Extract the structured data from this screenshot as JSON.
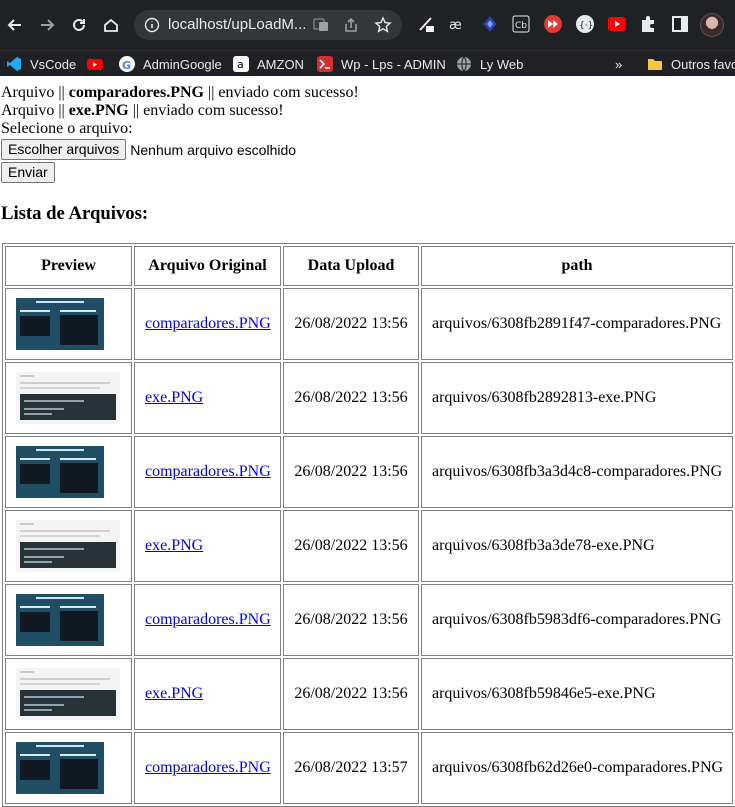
{
  "browser": {
    "url": "localhost/upLoadM...",
    "bookmarks": [
      {
        "label": "VsCode",
        "icon": "vscode-icon",
        "color": "#23a9f2"
      },
      {
        "label": "",
        "icon": "youtube-icon",
        "color": "#ff0000"
      },
      {
        "label": "AdminGoogle",
        "icon": "google-icon",
        "color": "#ffffff"
      },
      {
        "label": "AMZON",
        "icon": "amazon-icon",
        "color": "#ffffff"
      },
      {
        "label": "Wp - Lps - ADMIN",
        "icon": "wp-icon",
        "color": "#d32f2f"
      },
      {
        "label": "Ly Web",
        "icon": "globe-icon",
        "color": "#9aa0a6"
      }
    ],
    "more_label": "»",
    "other_folder_label": "Outros favor"
  },
  "page": {
    "messages": [
      {
        "prefix": "Arquivo || ",
        "filename": "comparadores.PNG",
        "suffix": " || enviado com sucesso!"
      },
      {
        "prefix": "Arquivo || ",
        "filename": "exe.PNG",
        "suffix": " || enviado com sucesso!"
      }
    ],
    "select_label": "Selecione o arquivo:",
    "choose_button": "Escolher arquivos",
    "no_file_text": "Nenhum arquivo escolhido",
    "send_button": "Enviar",
    "list_title": "Lista de Arquivos:",
    "table": {
      "headers": [
        "Preview",
        "Arquivo Original",
        "Data Upload",
        "path"
      ],
      "rows": [
        {
          "thumb": "comp",
          "name": "comparadores.PNG",
          "date": "26/08/2022 13:56",
          "path": "arquivos/6308fb2891f47-comparadores.PNG"
        },
        {
          "thumb": "exe",
          "name": "exe.PNG",
          "date": "26/08/2022 13:56",
          "path": "arquivos/6308fb2892813-exe.PNG"
        },
        {
          "thumb": "comp",
          "name": "comparadores.PNG",
          "date": "26/08/2022 13:56",
          "path": "arquivos/6308fb3a3d4c8-comparadores.PNG"
        },
        {
          "thumb": "exe",
          "name": "exe.PNG",
          "date": "26/08/2022 13:56",
          "path": "arquivos/6308fb3a3de78-exe.PNG"
        },
        {
          "thumb": "comp",
          "name": "comparadores.PNG",
          "date": "26/08/2022 13:56",
          "path": "arquivos/6308fb5983df6-comparadores.PNG"
        },
        {
          "thumb": "exe",
          "name": "exe.PNG",
          "date": "26/08/2022 13:56",
          "path": "arquivos/6308fb59846e5-exe.PNG"
        },
        {
          "thumb": "comp",
          "name": "comparadores.PNG",
          "date": "26/08/2022 13:57",
          "path": "arquivos/6308fb62d26e0-comparadores.PNG"
        }
      ]
    }
  }
}
